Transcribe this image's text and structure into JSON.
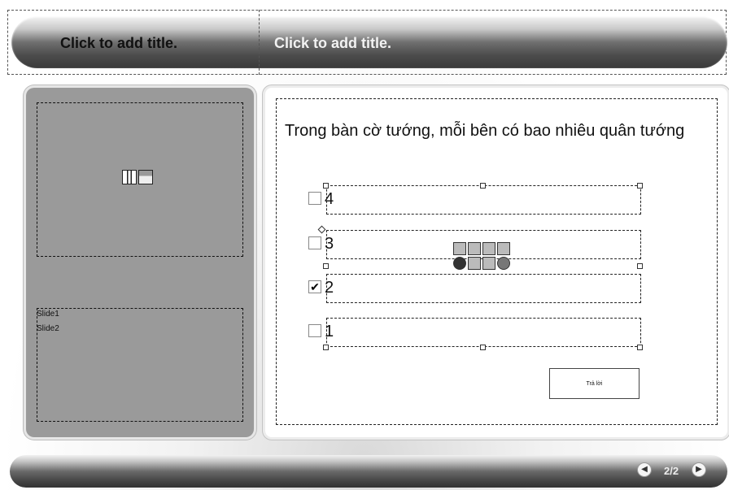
{
  "header": {
    "title_left": "Click to add title.",
    "title_right": "Click to add title."
  },
  "sidebar": {
    "slides": [
      "Slide1",
      "Slide2"
    ]
  },
  "question": {
    "text": "Trong bàn cờ tướng, mỗi bên có bao nhiêu quân tướng",
    "options": [
      {
        "label": "4",
        "checked": false
      },
      {
        "label": "3",
        "checked": false
      },
      {
        "label": "2",
        "checked": true
      },
      {
        "label": "1",
        "checked": false
      }
    ],
    "answer_button": "Trả lời"
  },
  "footer": {
    "page": "2/2",
    "prev_icon": "circle-arrow-left-icon",
    "next_icon": "circle-arrow-right-icon"
  }
}
